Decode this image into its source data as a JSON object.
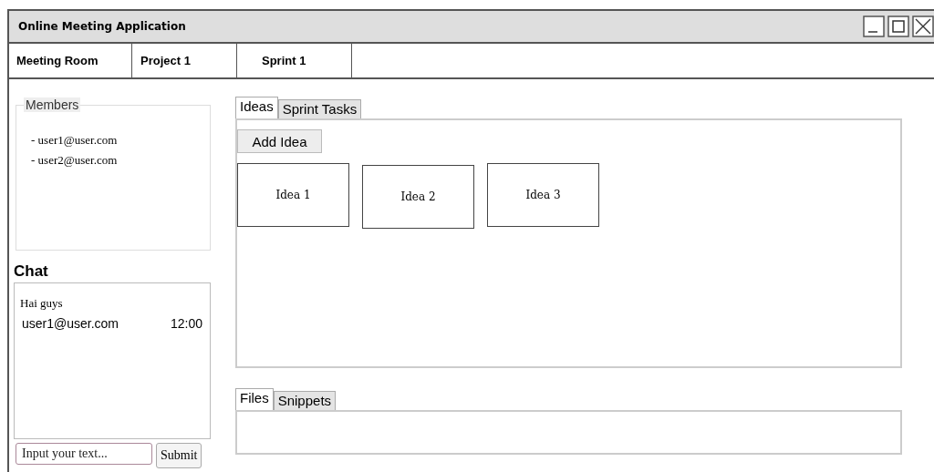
{
  "window": {
    "title": "Online Meeting Application"
  },
  "nav": [
    "Meeting Room",
    "Project 1",
    "Sprint 1"
  ],
  "members": {
    "title": "Members",
    "items": [
      "- user1@user.com",
      "- user2@user.com"
    ]
  },
  "chat": {
    "title": "Chat",
    "messages": [
      {
        "text": "Hai guys",
        "sender": "user1@user.com",
        "time": "12:00"
      }
    ],
    "input": {
      "placeholder": "Input your text..."
    },
    "submit": "Submit"
  },
  "ideas_tabs": [
    {
      "label": "Ideas",
      "selected": true
    },
    {
      "label": "Sprint Tasks",
      "selected": false
    }
  ],
  "add_idea": "Add Idea",
  "ideas": [
    "Idea 1",
    "Idea 2",
    "Idea 3"
  ],
  "files_tabs": [
    {
      "label": "Files",
      "selected": true
    },
    {
      "label": "Snippets",
      "selected": false
    }
  ]
}
